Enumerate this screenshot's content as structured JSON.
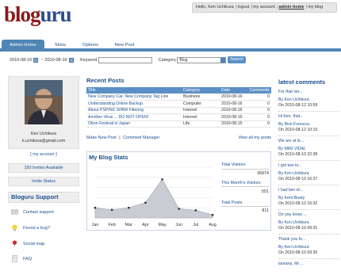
{
  "logo": {
    "part1": "blog",
    "part2": "uru"
  },
  "top_nav": {
    "greeting": "Hello, Ken Uchikura",
    "links": [
      "logout",
      "my account",
      "admin home",
      "my blog"
    ],
    "active": "admin home"
  },
  "tabs": [
    {
      "label": "Admin Home",
      "active": true
    },
    {
      "label": "Skins",
      "active": false
    },
    {
      "label": "Options",
      "active": false
    },
    {
      "label": "New Post",
      "active": false
    }
  ],
  "filter": {
    "date_from": "2010-08-16",
    "date_sep": "~",
    "date_to": "2010-08-16",
    "keyword_label": "Keyword",
    "keyword_value": "",
    "category_label": "Category",
    "category_value": "Blog",
    "search_label": "Search"
  },
  "profile": {
    "name": "Ken Uchikura",
    "email": "k.uchikura@gmail.com",
    "my_account": "[ my account ]",
    "invites": "150 Invites Available",
    "invite_status": "Invite Status"
  },
  "support": {
    "title": "Bloguru Support",
    "items": [
      "Contact support",
      "Found a bug?",
      "Social map",
      "FAQ"
    ]
  },
  "recent_posts": {
    "title": "Recent Posts",
    "columns": [
      "Title",
      "Category",
      "Date",
      "Comments"
    ],
    "rows": [
      {
        "title": "New Company Car, New Company Tag Line",
        "category": "Business",
        "date": "2010-08-16",
        "comments": "0"
      },
      {
        "title": "Understanding Online Backup",
        "category": "Computer",
        "date": "2010-08-16",
        "comments": "0"
      },
      {
        "title": "About PSP/NC SPAM Filtering",
        "category": "Internet",
        "date": "2010-08-16",
        "comments": "0"
      },
      {
        "title": "Another Virus ... DO NOT OPEN!",
        "category": "Internet",
        "date": "2010-08-16",
        "comments": "0"
      },
      {
        "title": "Obon Festival in Japan",
        "category": "Life",
        "date": "2010-08-15",
        "comments": "0"
      }
    ],
    "make_new_post": "Make New Post",
    "separator": "|",
    "comment_manager": "Comment Manager",
    "view_all": "View all my posts"
  },
  "blog_stats": {
    "title": "My Blog Stats",
    "total_visitors_label": "Total Visitors",
    "total_visitors_value": "36874",
    "month_visitors_label": "This Month's Visitors",
    "month_visitors_value": "551",
    "total_posts_label": "Total Posts",
    "total_posts_value": "811"
  },
  "chart_data": {
    "type": "area",
    "categories": [
      "Jan",
      "Feb",
      "Mar",
      "Apr",
      "May",
      "Jun",
      "Jul",
      "Aug"
    ],
    "values": [
      1000,
      800,
      1000,
      1500,
      3800,
      900,
      750,
      300
    ],
    "ylim": [
      0,
      5000
    ],
    "grid": true,
    "color": "#c9cdd3"
  },
  "latest_comments": {
    "title": "latest comments",
    "items": [
      {
        "text": "For that ver...",
        "by": "By Ken Uchikura",
        "date": "On 2010-08-12 10:59"
      },
      {
        "text": "Hi Ken, that...",
        "by": "By Rick Fonceca",
        "date": "On 2010-08-12 10:15"
      },
      {
        "text": "We are at le...",
        "by": "By MIRI VIDAL",
        "date": "On 2010-08-10 22:38"
      },
      {
        "text": "I got two to...",
        "by": "By Ken Uchikura",
        "date": "On 2010-08-10 16:37"
      },
      {
        "text": "I had two of...",
        "by": "By Kent Brady",
        "date": "On 2010-08-10 16:32"
      },
      {
        "text": "Do you know ...",
        "by": "By Ken Uchikura",
        "date": "On 2010-08-10 09:31"
      },
      {
        "text": "Thank you fo...",
        "by": "By Ken Uchikura",
        "date": "On 2010-08-10 09:30"
      },
      {
        "text": "laorana, Mr ...",
        "by": "",
        "date": ""
      }
    ]
  }
}
